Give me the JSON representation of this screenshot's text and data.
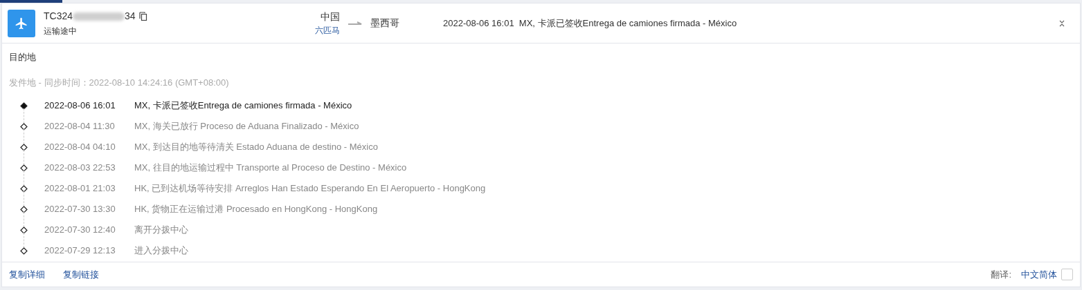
{
  "shipment": {
    "tracking_start": "TC324",
    "tracking_end": "34",
    "status": "运输途中",
    "origin": "中国",
    "origin_sub": "六匹马",
    "destination": "墨西哥",
    "latest_event": "2022-08-06 16:01  MX, 卡派已签收Entrega de camiones firmada - México"
  },
  "destination_label": "目的地",
  "origin_line": {
    "label": "发件地",
    "sync": " - 同步时间：2022-08-10 14:24:16 (GMT+08:00)"
  },
  "events": [
    {
      "time": "2022-08-06 16:01",
      "text": "MX, 卡派已签收Entrega de camiones firmada - México",
      "latest": true
    },
    {
      "time": "2022-08-04 11:30",
      "text": "MX, 海关已放行 Proceso de Aduana Finalizado - México",
      "latest": false
    },
    {
      "time": "2022-08-04 04:10",
      "text": "MX, 到达目的地等待清关 Estado Aduana de destino - México",
      "latest": false
    },
    {
      "time": "2022-08-03 22:53",
      "text": "MX, 往目的地运输过程中 Transporte al Proceso de Destino - México",
      "latest": false
    },
    {
      "time": "2022-08-01 21:03",
      "text": "HK, 已到达机场等待安排 Arreglos Han Estado Esperando En El Aeropuerto - HongKong",
      "latest": false
    },
    {
      "time": "2022-07-30 13:30",
      "text": "HK, 货物正在运输过港 Procesado en HongKong - HongKong",
      "latest": false
    },
    {
      "time": "2022-07-30 12:40",
      "text": "离开分拨中心",
      "latest": false
    },
    {
      "time": "2022-07-29 12:13",
      "text": "进入分拨中心",
      "latest": false
    }
  ],
  "footer": {
    "links": [
      "复制详细",
      "复制链接"
    ],
    "translate_label": "翻译:",
    "language": "中文简体",
    "checked": false
  }
}
